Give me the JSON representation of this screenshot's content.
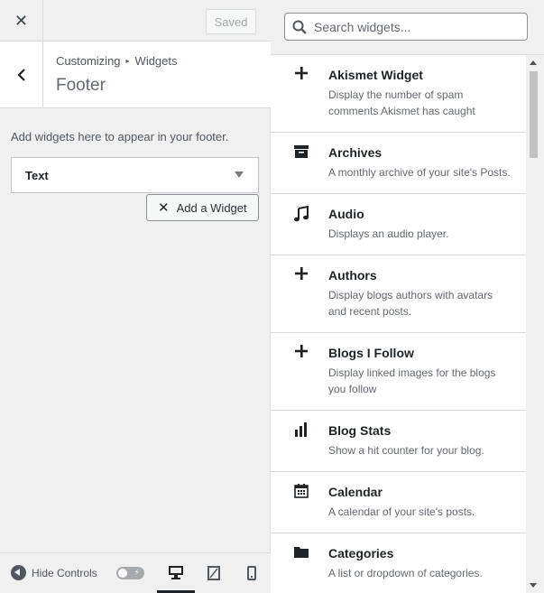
{
  "topbar": {
    "close_glyph": "✕",
    "saved_label": "Saved"
  },
  "section": {
    "breadcrumb_parent": "Customizing",
    "breadcrumb_sep": "▸",
    "breadcrumb_current": "Widgets",
    "title": "Footer",
    "description": "Add widgets here to appear in your footer."
  },
  "widgets_area": {
    "items": [
      {
        "label": "Text"
      }
    ],
    "add_button_label": "Add a Widget",
    "add_button_glyph": "✕"
  },
  "footer": {
    "hide_controls_label": "Hide Controls",
    "toggle_glyph": "⚡",
    "devices": [
      "desktop",
      "tablet",
      "mobile"
    ],
    "active_device": "desktop"
  },
  "search": {
    "placeholder": "Search widgets..."
  },
  "widget_list": [
    {
      "icon": "plus-icon",
      "title": "Akismet Widget",
      "desc": "Display the number of spam comments Akismet has caught"
    },
    {
      "icon": "archive-icon",
      "title": "Archives",
      "desc": "A monthly archive of your site's Posts."
    },
    {
      "icon": "music-icon",
      "title": "Audio",
      "desc": "Displays an audio player."
    },
    {
      "icon": "plus-icon",
      "title": "Authors",
      "desc": "Display blogs authors with avatars and recent posts."
    },
    {
      "icon": "plus-icon",
      "title": "Blogs I Follow",
      "desc": "Display linked images for the blogs you follow"
    },
    {
      "icon": "chart-bar-icon",
      "title": "Blog Stats",
      "desc": "Show a hit counter for your blog."
    },
    {
      "icon": "calendar-icon",
      "title": "Calendar",
      "desc": "A calendar of your site's posts."
    },
    {
      "icon": "folder-icon",
      "title": "Categories",
      "desc": "A list or dropdown of categories."
    }
  ],
  "colors": {
    "accent": "#1d2327",
    "panel_bg": "#f0f0f1",
    "border": "#dcdcde",
    "muted_text": "#646970"
  }
}
